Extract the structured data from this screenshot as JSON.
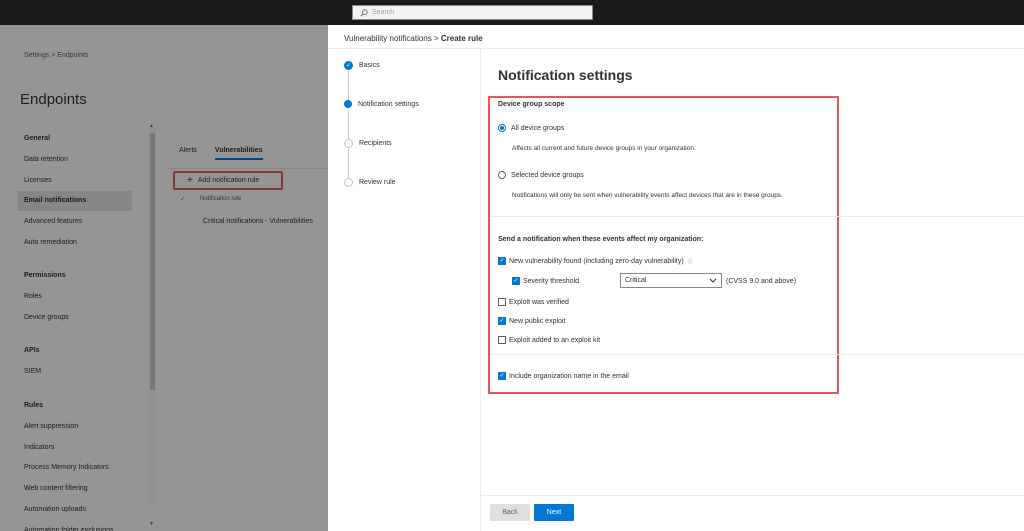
{
  "topbar": {
    "search_placeholder": "Search"
  },
  "background": {
    "breadcrumb": "Settings  >  Endpoints",
    "page_title": "Endpoints",
    "nav": {
      "general": "General",
      "general_items": [
        "Data retention",
        "Licenses",
        "Email notifications",
        "Advanced features",
        "Auto remediation"
      ],
      "permissions": "Permissions",
      "permissions_items": [
        "Roles",
        "Device groups"
      ],
      "apis": "APIs",
      "apis_items": [
        "SIEM"
      ],
      "rules": "Rules",
      "rules_items": [
        "Alert suppression",
        "Indicators",
        "Process Memory Indicators",
        "Web content filtering",
        "Automation uploads",
        "Automation folder exclusions"
      ]
    },
    "tabs": [
      "Alerts",
      "Vulnerabilities"
    ],
    "add_rule_label": "Add notification rule",
    "list_header": "Notification rule",
    "list_row": "Critical notifications - Vulnerabilities"
  },
  "panel": {
    "breadcrumb_parent": "Vulnerability notifications",
    "breadcrumb_sep": ">",
    "breadcrumb_current": "Create rule",
    "steps": [
      "Basics",
      "Notification settings",
      "Recipients",
      "Review rule"
    ],
    "title": "Notification settings",
    "scope_title": "Device group scope",
    "scope_all": "All device groups",
    "scope_all_desc": "Affects all current and future device groups in your organization.",
    "scope_selected": "Selected device groups",
    "scope_selected_desc": "Notifications will only be sent when vulnerability events affect devices that are in these groups.",
    "events_title": "Send a notification when these events affect my organization:",
    "opt_new_vuln": "New vulnerability found (including zero-day vulnerability)",
    "opt_severity": "Severity threshold",
    "severity_value": "Critical",
    "cvss_note": "(CVSS 9.0 and above)",
    "opt_exploit_verified": "Exploit was verified",
    "opt_new_exploit": "New public exploit",
    "opt_exploit_kit": "Exploit added to an exploit kit",
    "opt_include_org": "Include organization name in the email",
    "back_label": "Back",
    "next_label": "Next"
  }
}
